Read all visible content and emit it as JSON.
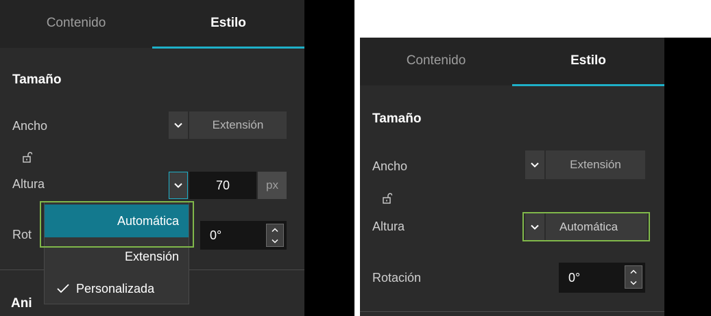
{
  "tabs": {
    "content": "Contenido",
    "style": "Estilo"
  },
  "section_size": "Tamaño",
  "width": {
    "label": "Ancho",
    "value": "Extensión"
  },
  "height": {
    "label": "Altura",
    "value_number": "70",
    "unit": "px",
    "value_mode": "Automática"
  },
  "rotation": {
    "label": "Rotación",
    "label_clipped_left": "Rot",
    "value": "0°"
  },
  "animation_section_clipped": "Ani",
  "dropdown": {
    "items": [
      "Automática",
      "Extensión",
      "Personalizada"
    ],
    "selected": "Automática",
    "checked": "Personalizada"
  },
  "colors": {
    "accent": "#1eb0c8",
    "highlight": "#80b84a",
    "selected_bg": "#13798e"
  }
}
